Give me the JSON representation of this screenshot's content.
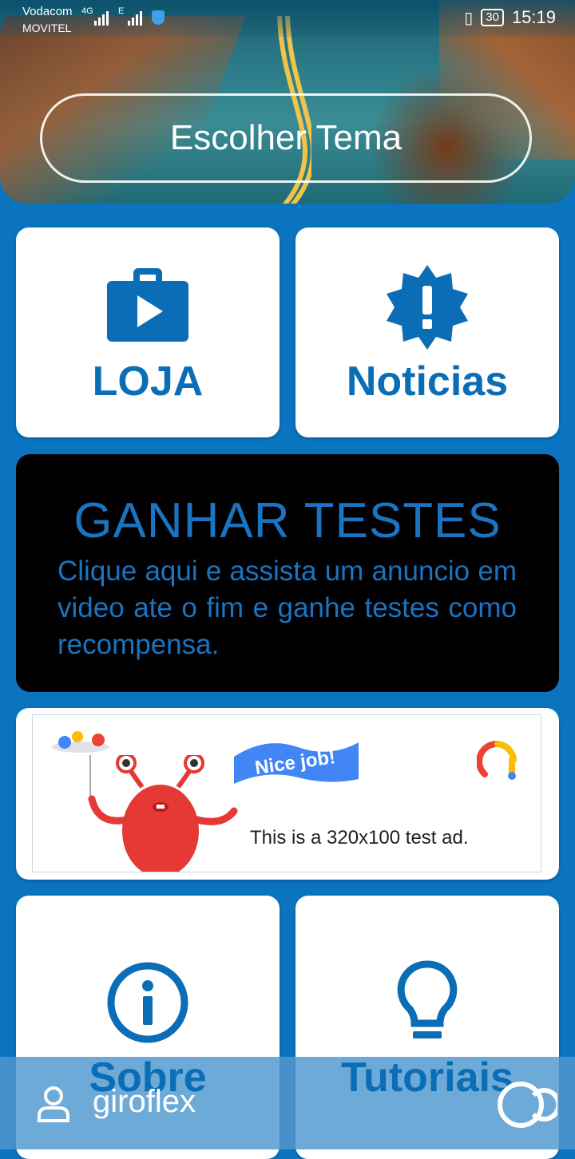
{
  "status_bar": {
    "carrier_primary": "Vodacom",
    "carrier_secondary": "MOVITEL",
    "network_1": "4G",
    "network_2": "E",
    "battery": "30",
    "time": "15:19"
  },
  "header": {
    "theme_button_label": "Escolher Tema"
  },
  "cards": {
    "store_label": "LOJA",
    "news_label": "Noticias",
    "about_label": "Sobre",
    "tutorials_label": "Tutoriais"
  },
  "promo": {
    "title": "GANHAR TESTES",
    "text": "Clique aqui e assista um anuncio em video ate o fim e ganhe testes como recompensa."
  },
  "ad": {
    "flag_text": "Nice job!",
    "body_text": "This is a 320x100 test ad."
  },
  "bottom_bar": {
    "user_name": "giroflex"
  },
  "colors": {
    "background": "#0a74bf",
    "accent": "#0a6db5",
    "promo_text": "#1a74c2"
  }
}
